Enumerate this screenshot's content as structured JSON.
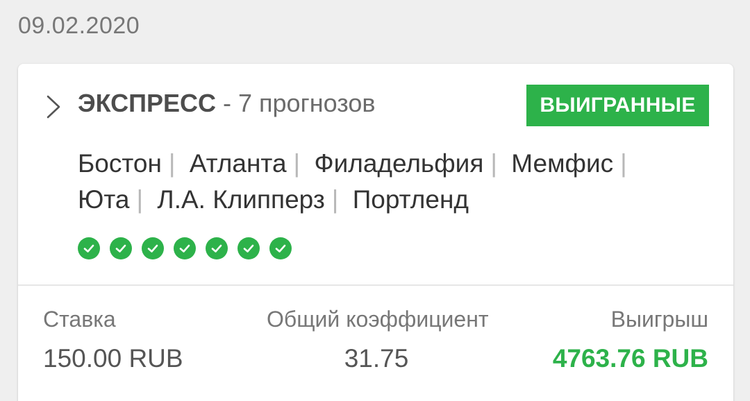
{
  "date": "09.02.2020",
  "bet": {
    "type": "ЭКСПРЕСС",
    "count_text": "- 7 прогнозов",
    "status": "ВЫИГРАННЫЕ",
    "teams": [
      "Бостон",
      "Атланта",
      "Филадельфия",
      "Мемфис",
      "Юта",
      "Л.А. Клипперз",
      "Портленд"
    ],
    "results": [
      "won",
      "won",
      "won",
      "won",
      "won",
      "won",
      "won"
    ],
    "stake_label": "Ставка",
    "stake_value": "150.00 RUB",
    "odds_label": "Общий коэффициент",
    "odds_value": "31.75",
    "payout_label": "Выигрыш",
    "payout_value": "4763.76 RUB"
  },
  "icons": {
    "expand": "chevron-right-icon",
    "result": "check-circle-icon"
  },
  "colors": {
    "accent": "#2db24a",
    "background": "#efefef",
    "card": "#ffffff"
  }
}
